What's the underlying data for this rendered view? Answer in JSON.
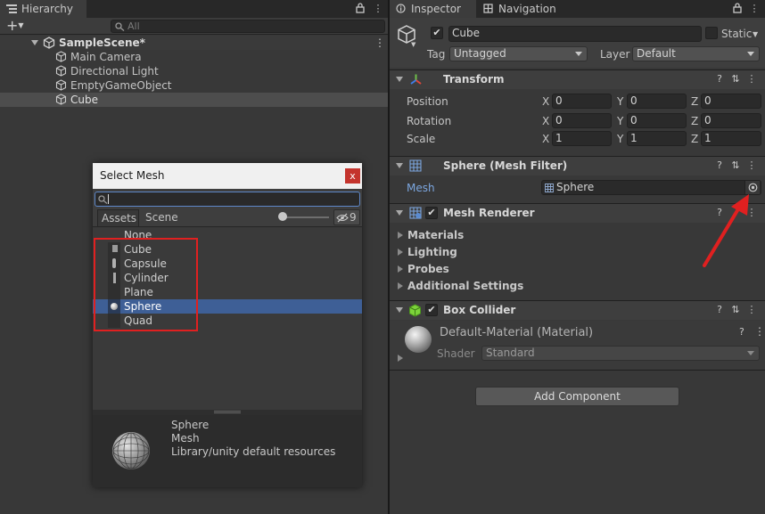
{
  "hierarchy": {
    "tab_label": "Hierarchy",
    "add_label": "+",
    "search_placeholder": "All",
    "scene_name": "SampleScene*",
    "items": [
      {
        "label": "Main Camera"
      },
      {
        "label": "Directional Light"
      },
      {
        "label": "EmptyGameObject"
      },
      {
        "label": "Cube"
      }
    ]
  },
  "inspector": {
    "tab_label": "Inspector",
    "nav_tab_label": "Navigation",
    "object_name": "Cube",
    "static_label": "Static",
    "tag_label": "Tag",
    "tag_value": "Untagged",
    "layer_label": "Layer",
    "layer_value": "Default",
    "transform": {
      "title": "Transform",
      "position_label": "Position",
      "rotation_label": "Rotation",
      "scale_label": "Scale",
      "axis_x": "X",
      "axis_y": "Y",
      "axis_z": "Z",
      "position": {
        "x": "0",
        "y": "0",
        "z": "0"
      },
      "rotation": {
        "x": "0",
        "y": "0",
        "z": "0"
      },
      "scale": {
        "x": "1",
        "y": "1",
        "z": "1"
      }
    },
    "mesh_filter": {
      "title": "Sphere (Mesh Filter)",
      "mesh_label": "Mesh",
      "mesh_value": "Sphere"
    },
    "mesh_renderer": {
      "title": "Mesh Renderer",
      "sections": [
        "Materials",
        "Lighting",
        "Probes",
        "Additional Settings"
      ]
    },
    "box_collider": {
      "title": "Box Collider",
      "material_name": "Default-Material (Material)",
      "shader_label": "Shader",
      "shader_value": "Standard"
    },
    "add_component_label": "Add Component"
  },
  "dialog": {
    "title": "Select Mesh",
    "close_label": "x",
    "search_value": "",
    "tab_assets": "Assets",
    "tab_scene": "Scene",
    "hidden_count": "9",
    "items": [
      {
        "label": "None"
      },
      {
        "label": "Cube"
      },
      {
        "label": "Capsule"
      },
      {
        "label": "Cylinder"
      },
      {
        "label": "Plane"
      },
      {
        "label": "Sphere"
      },
      {
        "label": "Quad"
      }
    ],
    "selected_item": "Sphere",
    "preview": {
      "name": "Sphere",
      "type": "Mesh",
      "path": "Library/unity default resources"
    }
  },
  "colors": {
    "selection": "#3e5f96",
    "highlight_box": "#e02020",
    "dialog_title_bar": "#f0f0f0",
    "link_blue": "#7ca7e0"
  }
}
